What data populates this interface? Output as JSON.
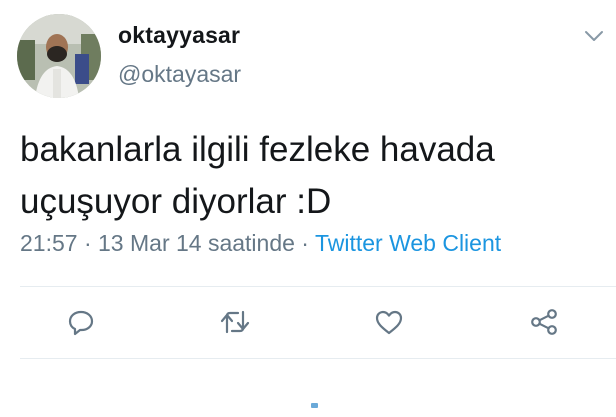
{
  "tweet": {
    "display_name": "oktayyasar",
    "handle": "@oktayasar",
    "text_line1": "bakanlarla ilgili fezleke havada",
    "text_line2": "uçuşuyor diyorlar :D",
    "time": "21:57",
    "separator": " · ",
    "date": "13 Mar 14 saatinde",
    "client": "Twitter Web Client"
  },
  "icons": {
    "reply": "reply-icon",
    "retweet": "retweet-icon",
    "like": "heart-icon",
    "share": "share-icon",
    "caret": "chevron-down-icon"
  },
  "colors": {
    "text": "#14171a",
    "secondary": "#657786",
    "link": "#1b95e0",
    "divider": "#e6ecf0"
  }
}
